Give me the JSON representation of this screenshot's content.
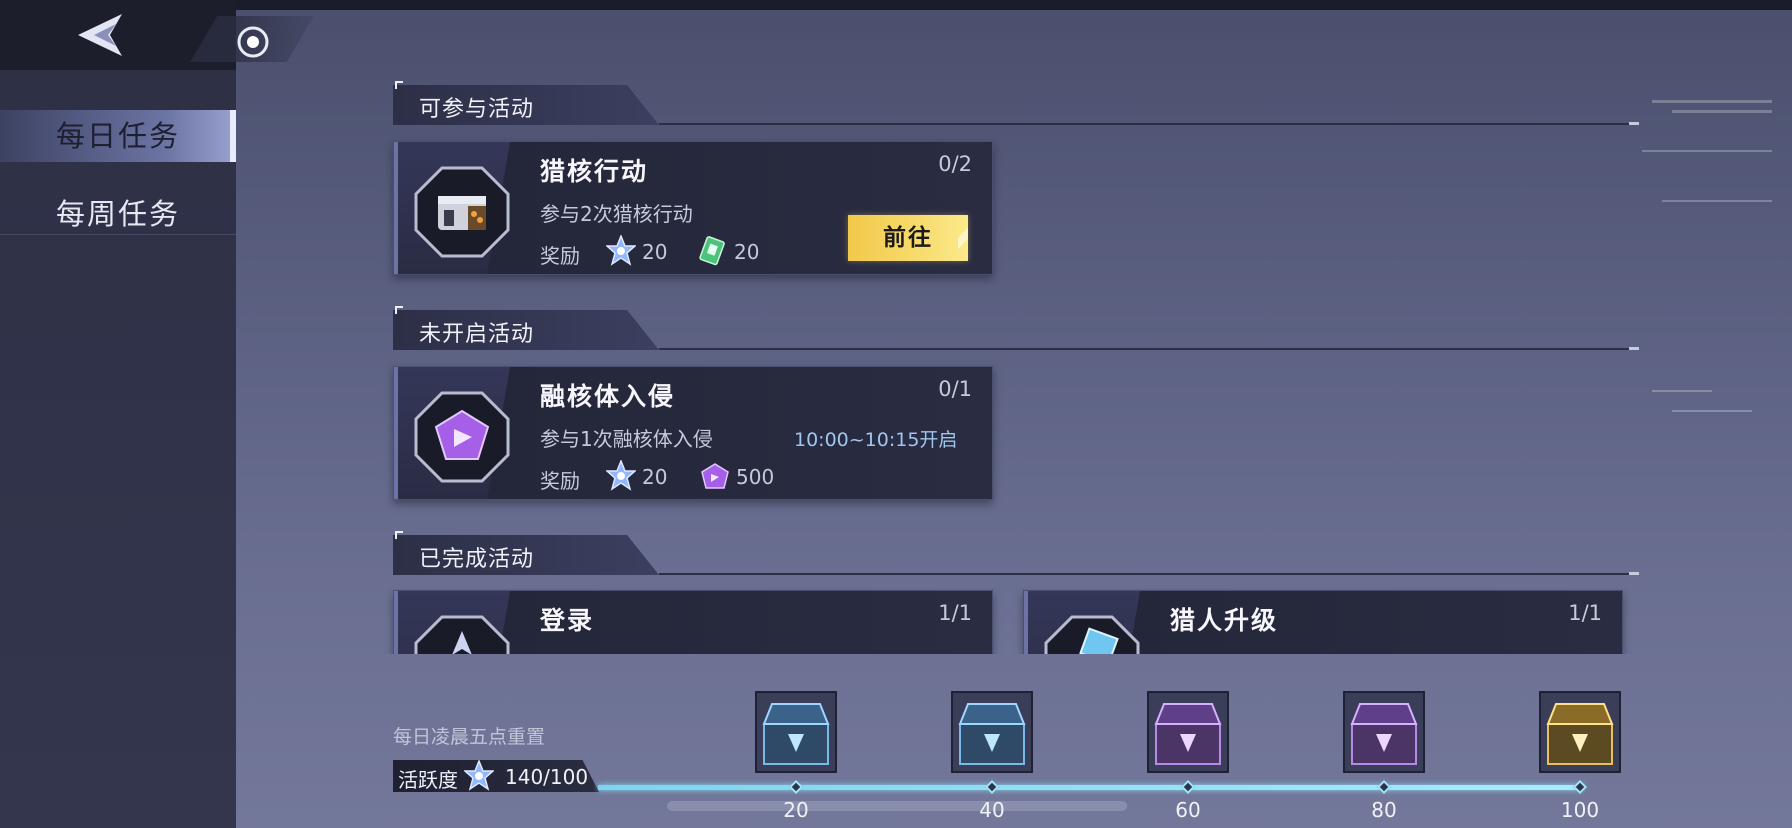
{
  "sidebar": {
    "tabs": [
      {
        "label": "每日任务",
        "active": true
      },
      {
        "label": "每周任务",
        "active": false
      }
    ]
  },
  "sections": [
    {
      "label": "可参与活动"
    },
    {
      "label": "未开启活动"
    },
    {
      "label": "已完成活动"
    }
  ],
  "tasks": {
    "hunt": {
      "title": "猎核行动",
      "progress": "0/2",
      "desc": "参与2次猎核行动",
      "reward_label": "奖励",
      "reward1": "20",
      "reward2": "20",
      "button": "前往"
    },
    "invasion": {
      "title": "融核体入侵",
      "progress": "0/1",
      "desc": "参与1次融核体入侵",
      "time": "10:00~10:15开启",
      "reward_label": "奖励",
      "reward1": "20",
      "reward2": "500"
    },
    "login": {
      "title": "登录",
      "progress": "1/1"
    },
    "levelup": {
      "title": "猎人升级",
      "progress": "1/1"
    }
  },
  "activity": {
    "reset_note": "每日凌晨五点重置",
    "label": "活跃度",
    "value": "140/100",
    "milestones": [
      "20",
      "40",
      "60",
      "80",
      "100"
    ]
  },
  "colors": {
    "accent_button": "#f2c84a",
    "progress": "#7ad6f0"
  }
}
